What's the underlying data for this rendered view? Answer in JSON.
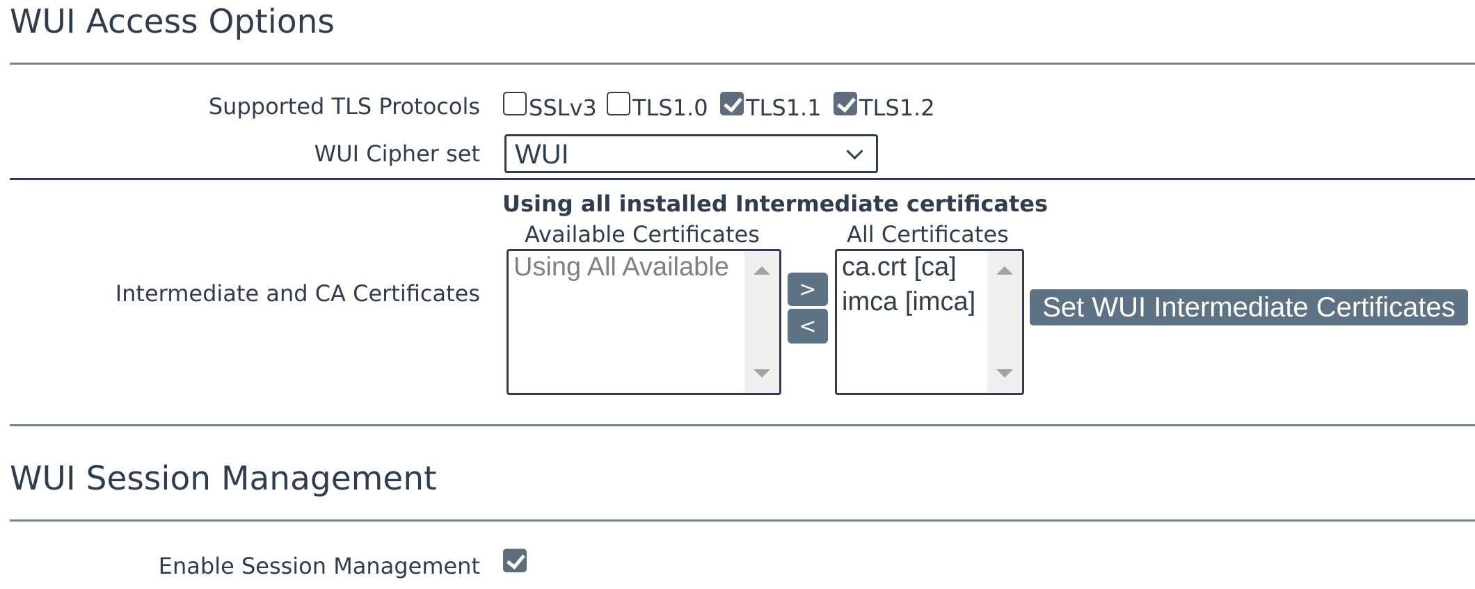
{
  "access": {
    "title": "WUI Access Options",
    "tls": {
      "label": "Supported TLS Protocols",
      "options": [
        {
          "label": "SSLv3",
          "checked": false
        },
        {
          "label": "TLS1.0",
          "checked": false
        },
        {
          "label": "TLS1.1",
          "checked": true
        },
        {
          "label": "TLS1.2",
          "checked": true
        }
      ]
    },
    "cipher": {
      "label": "WUI Cipher set",
      "value": "WUI"
    },
    "certs": {
      "label": "Intermediate and CA Certificates",
      "status": "Using all installed Intermediate certificates",
      "available_header": "Available Certificates",
      "available_items": [
        "Using All Available"
      ],
      "all_header": "All Certificates",
      "all_items": [
        "ca.crt [ca]",
        "imca [imca]"
      ],
      "add_label": ">",
      "remove_label": "<",
      "set_button": "Set WUI Intermediate Certificates"
    }
  },
  "session": {
    "title": "WUI Session Management",
    "enable_label": "Enable Session Management",
    "enable_checked": true
  },
  "icons": {
    "checkbox": "checkbox-icon",
    "dropdown": "chevron-down-icon",
    "scroll_up": "scroll-up-icon",
    "scroll_down": "scroll-down-icon"
  }
}
